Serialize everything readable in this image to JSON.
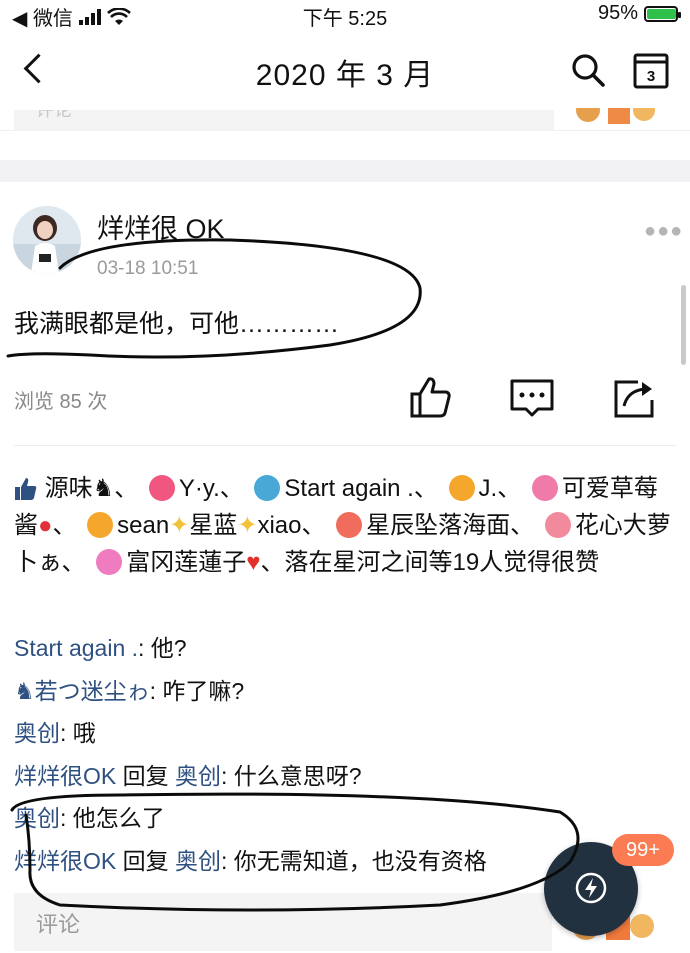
{
  "status_bar": {
    "back_app": "◀ 微信",
    "time": "下午 5:25",
    "battery": "95%",
    "battery_level": 0.95
  },
  "nav": {
    "title": "2020 年 3 月"
  },
  "prev_card": {
    "comment_placeholder": "评论"
  },
  "post": {
    "author": "烊烊很 OK",
    "time": "03-18 10:51",
    "content": "我满眼都是他，可他…………",
    "views": "浏览 85 次",
    "likes": {
      "users": [
        "源味",
        "Y·y.",
        "Start again .",
        "J.",
        "可爱草莓酱",
        "sean",
        "星蓝",
        "xiao",
        "星辰坠落海面",
        "花心大萝卜ぁ",
        "富冈莲蓮子",
        "落在星河之间"
      ],
      "count_part1": "等1",
      "count_part2": "9人觉得很赞"
    },
    "comments": [
      {
        "name": "Start again .",
        "text": ": 他?"
      },
      {
        "name": "若つ迷尘ゎ",
        "text": ": 咋了嘛?"
      },
      {
        "name": "奥创",
        "text": ": 哦"
      },
      {
        "name": "烊烊很OK",
        "reply": " 回复 ",
        "to": "奥创",
        "text": ": 什么意思呀?"
      },
      {
        "name": "奥创",
        "text": ": 他怎么了"
      },
      {
        "name": "烊烊很OK",
        "reply": " 回复 ",
        "to": "奥创",
        "text": ": 你无需知道，也没有资格"
      }
    ],
    "comment_placeholder": "评论"
  },
  "notification": {
    "badge": "99+"
  },
  "colors": {
    "name_blue": "#2f5181",
    "badge_orange": "#fb7b53",
    "fab": "#22313f",
    "battery_green": "#2fc14b"
  },
  "icons": [
    "back-icon",
    "search-icon",
    "calendar-icon",
    "more-icon",
    "like-icon",
    "comment-icon",
    "share-icon",
    "bolt-icon"
  ]
}
